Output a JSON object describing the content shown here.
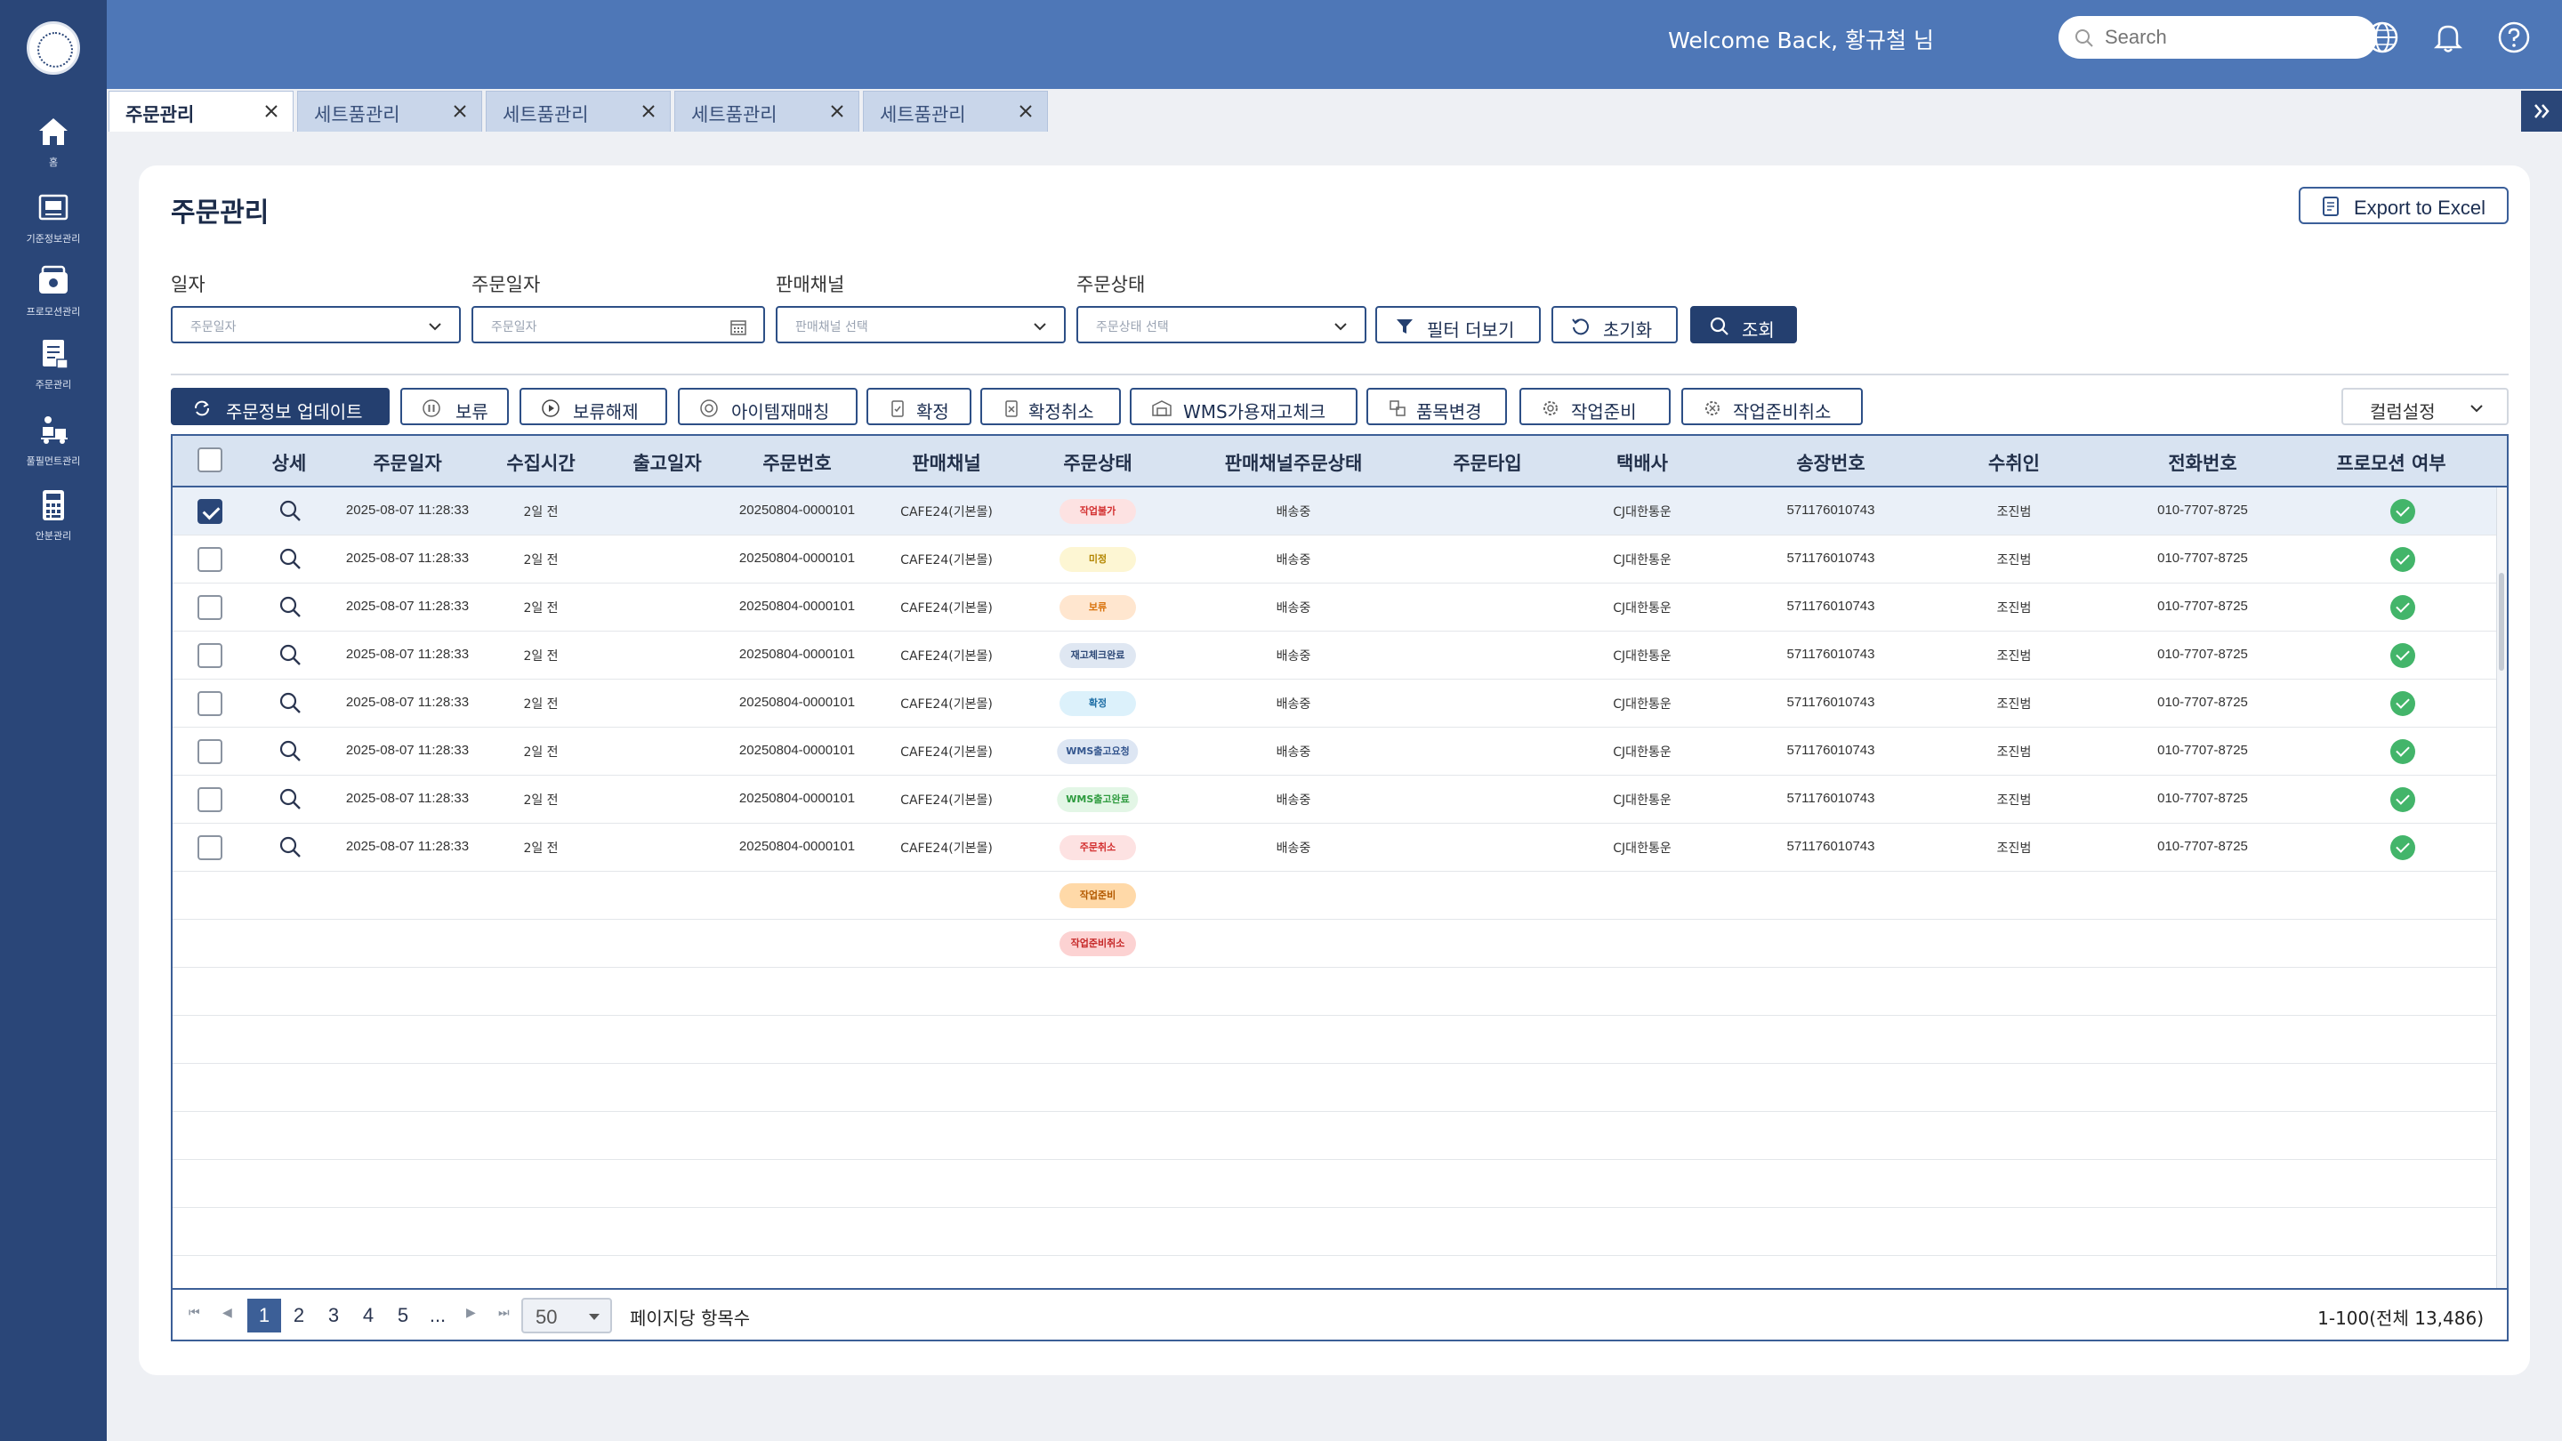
{
  "sidebar": {
    "items": [
      {
        "label": "홈",
        "icon": "home-icon"
      },
      {
        "label": "기준정보관리",
        "icon": "master-data-icon"
      },
      {
        "label": "프로모션관리",
        "icon": "promotion-icon"
      },
      {
        "label": "주문관리",
        "icon": "order-icon"
      },
      {
        "label": "풀필먼트관리",
        "icon": "fulfillment-icon"
      },
      {
        "label": "안분관리",
        "icon": "calculator-icon"
      }
    ]
  },
  "header": {
    "welcome": "Welcome Back, 황규철 님",
    "search_placeholder": "Search"
  },
  "tabs": [
    {
      "label": "주문관리",
      "active": true
    },
    {
      "label": "세트품관리",
      "active": false
    },
    {
      "label": "세트품관리",
      "active": false
    },
    {
      "label": "세트품관리",
      "active": false
    },
    {
      "label": "세트품관리",
      "active": false
    }
  ],
  "page": {
    "title": "주문관리",
    "export_label": "Export to Excel"
  },
  "filters": {
    "date_type": {
      "label": "일자",
      "value": "주문일자"
    },
    "order_date": {
      "label": "주문일자",
      "placeholder": "주문일자"
    },
    "channel": {
      "label": "판매채널",
      "placeholder": "판매채널 선택"
    },
    "status": {
      "label": "주문상태",
      "placeholder": "주문상태 선택"
    },
    "more_label": "필터 더보기",
    "reset_label": "초기화",
    "search_label": "조회"
  },
  "actions": {
    "update": "주문정보 업데이트",
    "hold": "보류",
    "unhold": "보류해제",
    "rematch": "아이템재매칭",
    "confirm": "확정",
    "unconfirm": "확정취소",
    "wms_check": "WMS가용재고체크",
    "item_change": "품목변경",
    "prepare": "작업준비",
    "unprepare": "작업준비취소",
    "column_settings": "컬럼설정"
  },
  "table": {
    "columns": [
      "상세",
      "주문일자",
      "수집시간",
      "출고일자",
      "주문번호",
      "판매채널",
      "주문상태",
      "판매채널주문상태",
      "주문타입",
      "택배사",
      "송장번호",
      "수취인",
      "전화번호",
      "프로모션 여부"
    ],
    "rows": [
      {
        "date": "2025-08-07 11:28:33",
        "collected": "2일 전",
        "ship_date": "",
        "order_no": "20250804-0000101",
        "channel": "CAFE24(기본몰)",
        "status": "작업불가",
        "channel_status": "배송중",
        "order_type": "",
        "carrier": "CJ대한통운",
        "tracking": "571176010743",
        "recipient": "조진범",
        "phone": "010-7707-8725"
      },
      {
        "date": "2025-08-07 11:28:33",
        "collected": "2일 전",
        "ship_date": "",
        "order_no": "20250804-0000101",
        "channel": "CAFE24(기본몰)",
        "status": "미정",
        "channel_status": "배송중",
        "order_type": "",
        "carrier": "CJ대한통운",
        "tracking": "571176010743",
        "recipient": "조진범",
        "phone": "010-7707-8725"
      },
      {
        "date": "2025-08-07 11:28:33",
        "collected": "2일 전",
        "ship_date": "",
        "order_no": "20250804-0000101",
        "channel": "CAFE24(기본몰)",
        "status": "보류",
        "channel_status": "배송중",
        "order_type": "",
        "carrier": "CJ대한통운",
        "tracking": "571176010743",
        "recipient": "조진범",
        "phone": "010-7707-8725"
      },
      {
        "date": "2025-08-07 11:28:33",
        "collected": "2일 전",
        "ship_date": "",
        "order_no": "20250804-0000101",
        "channel": "CAFE24(기본몰)",
        "status": "재고체크완료",
        "channel_status": "배송중",
        "order_type": "",
        "carrier": "CJ대한통운",
        "tracking": "571176010743",
        "recipient": "조진범",
        "phone": "010-7707-8725"
      },
      {
        "date": "2025-08-07 11:28:33",
        "collected": "2일 전",
        "ship_date": "",
        "order_no": "20250804-0000101",
        "channel": "CAFE24(기본몰)",
        "status": "확정",
        "channel_status": "배송중",
        "order_type": "",
        "carrier": "CJ대한통운",
        "tracking": "571176010743",
        "recipient": "조진범",
        "phone": "010-7707-8725"
      },
      {
        "date": "2025-08-07 11:28:33",
        "collected": "2일 전",
        "ship_date": "",
        "order_no": "20250804-0000101",
        "channel": "CAFE24(기본몰)",
        "status": "WMS출고요청",
        "channel_status": "배송중",
        "order_type": "",
        "carrier": "CJ대한통운",
        "tracking": "571176010743",
        "recipient": "조진범",
        "phone": "010-7707-8725"
      },
      {
        "date": "2025-08-07 11:28:33",
        "collected": "2일 전",
        "ship_date": "",
        "order_no": "20250804-0000101",
        "channel": "CAFE24(기본몰)",
        "status": "WMS출고완료",
        "channel_status": "배송중",
        "order_type": "",
        "carrier": "CJ대한통운",
        "tracking": "571176010743",
        "recipient": "조진범",
        "phone": "010-7707-8725"
      },
      {
        "date": "2025-08-07 11:28:33",
        "collected": "2일 전",
        "ship_date": "",
        "order_no": "20250804-0000101",
        "channel": "CAFE24(기본몰)",
        "status": "주문취소",
        "channel_status": "배송중",
        "order_type": "",
        "carrier": "CJ대한통운",
        "tracking": "571176010743",
        "recipient": "조진범",
        "phone": "010-7707-8725"
      }
    ],
    "legend_badges": [
      "작업준비",
      "작업준비취소"
    ],
    "status_colors": {
      "작업불가": {
        "bg": "#fde2e2",
        "fg": "#d32f2f"
      },
      "미정": {
        "bg": "#fdf6d3",
        "fg": "#b38600"
      },
      "보류": {
        "bg": "#ffe6cf",
        "fg": "#d9730d"
      },
      "재고체크완료": {
        "bg": "#dfe7f2",
        "fg": "#2f4a78"
      },
      "확정": {
        "bg": "#dcf1fb",
        "fg": "#1f6fa6"
      },
      "WMS출고요청": {
        "bg": "#dde6f3",
        "fg": "#35578f"
      },
      "WMS출고완료": {
        "bg": "#e3f6e6",
        "fg": "#2e9b3f"
      },
      "주문취소": {
        "bg": "#fde2e2",
        "fg": "#d32f2f"
      },
      "작업준비": {
        "bg": "#ffd9a8",
        "fg": "#b35a00"
      },
      "작업준비취소": {
        "bg": "#fcd2d2",
        "fg": "#c62828"
      }
    },
    "selected_row": 0
  },
  "pagination": {
    "pages": [
      "1",
      "2",
      "3",
      "4",
      "5",
      "..."
    ],
    "current": "1",
    "page_size": "50",
    "page_size_label": "페이지당 항목수",
    "total_text": "1-100(전체 13,486)"
  },
  "colors": {
    "sidebar": "#2a4678",
    "header": "#4e77b7",
    "accent": "#243f6f"
  }
}
